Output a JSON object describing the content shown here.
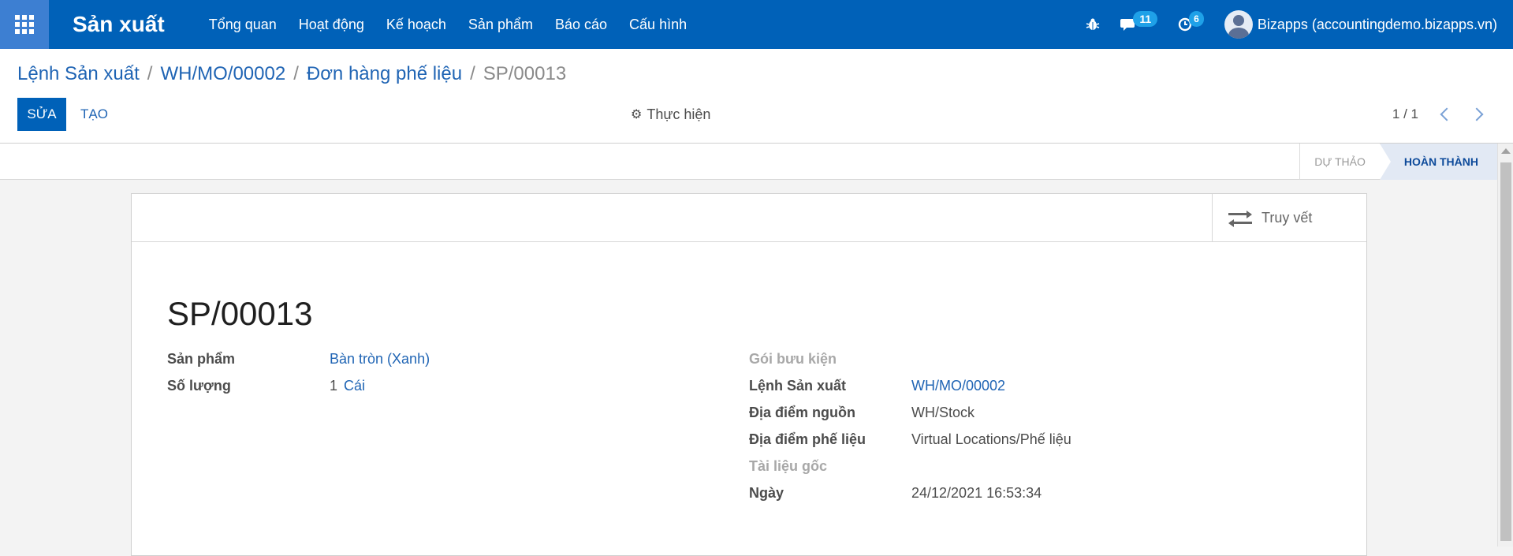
{
  "navbar": {
    "app_title": "Sản xuất",
    "menu": [
      "Tổng quan",
      "Hoạt động",
      "Kế hoạch",
      "Sản phẩm",
      "Báo cáo",
      "Cấu hình"
    ],
    "messages_count": "11",
    "activities_count": "6",
    "user": "Bizapps (accountingdemo.bizapps.vn)"
  },
  "breadcrumb": {
    "items": [
      "Lệnh Sản xuất",
      "WH/MO/00002",
      "Đơn hàng phế liệu"
    ],
    "current": "SP/00013"
  },
  "toolbar": {
    "edit_label": "SỬA",
    "create_label": "TẠO",
    "action_label": "Thực hiện"
  },
  "pager": {
    "value": "1 / 1"
  },
  "status": {
    "steps": [
      {
        "label": "DỰ THẢO",
        "active": false
      },
      {
        "label": "HOÀN THÀNH",
        "active": true
      }
    ]
  },
  "form": {
    "trace_label": "Truy vết",
    "title": "SP/00013",
    "left": {
      "product_label": "Sản phẩm",
      "product_value": "Bàn tròn (Xanh)",
      "quantity_label": "Số lượng",
      "quantity_value": "1",
      "quantity_uom": "Cái"
    },
    "right": {
      "package_label": "Gói bưu kiện",
      "mo_label": "Lệnh Sản xuất",
      "mo_value": "WH/MO/00002",
      "source_label": "Địa điểm nguồn",
      "source_value": "WH/Stock",
      "scrap_loc_label": "Địa điểm phế liệu",
      "scrap_loc_value": "Virtual Locations/Phế liệu",
      "origin_label": "Tài liệu gốc",
      "date_label": "Ngày",
      "date_value": "24/12/2021 16:53:34"
    }
  },
  "colors": {
    "navbar": "#0061b8",
    "apps_button": "#3d7fd2",
    "badge": "#1fa1e8",
    "link": "#1f64b4",
    "status_active_bg": "#e2e9f4"
  }
}
